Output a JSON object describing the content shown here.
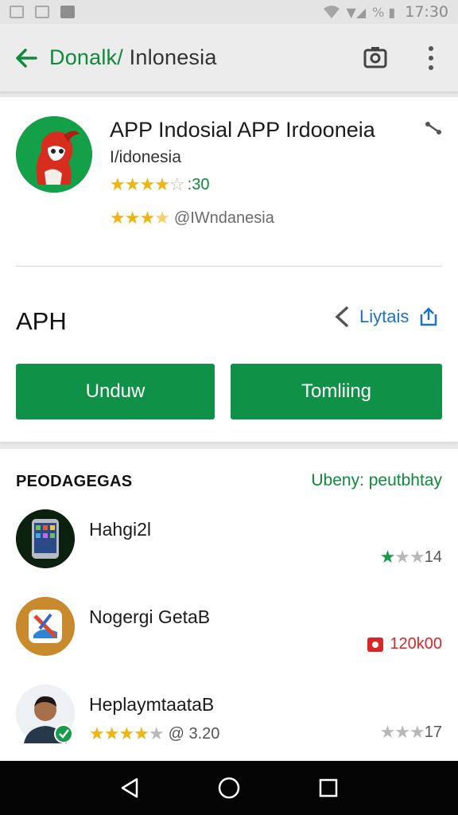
{
  "status_bar": {
    "signal_text": "▼◢",
    "battery_text": "% ▮",
    "time": "17:30"
  },
  "app_bar": {
    "title_green": "Donalk/",
    "title_dark": "Inlonesia"
  },
  "app": {
    "name": "APP Indosial APP Irdooneia",
    "region": "I/idonesia",
    "rating1_stars": "★★★",
    "rating1_prefix": "★",
    "rating1_empty": "☆",
    "rating1_value": ":30",
    "rating2_stars": "★★★",
    "rating2_half": "★",
    "rating2_value": "@IWndanesia"
  },
  "section": {
    "label": "APH",
    "more_label": "Liytais"
  },
  "buttons": {
    "download": "Unduw",
    "watch": "Tomliing"
  },
  "list": {
    "header": "PEODAGEGAS",
    "see_more": "Ubeny: peutbhtay",
    "items": [
      {
        "title": "Hahgi2l",
        "stars_full": "★",
        "stars_empty": "★★",
        "value": "14"
      },
      {
        "title": "Nogergi GetaB",
        "value": "120k00"
      },
      {
        "title": "HeplaymtaataB",
        "stars_full": "★★★★",
        "stars_empty": "★",
        "rating_value": "@ 3.20",
        "right_stars_full": "★★",
        "right_stars_empty": "★",
        "right_value": "17"
      }
    ]
  },
  "colors": {
    "brand_green": "#0f9147",
    "link_blue": "#1a73c8",
    "star_yellow": "#f2b20f"
  }
}
